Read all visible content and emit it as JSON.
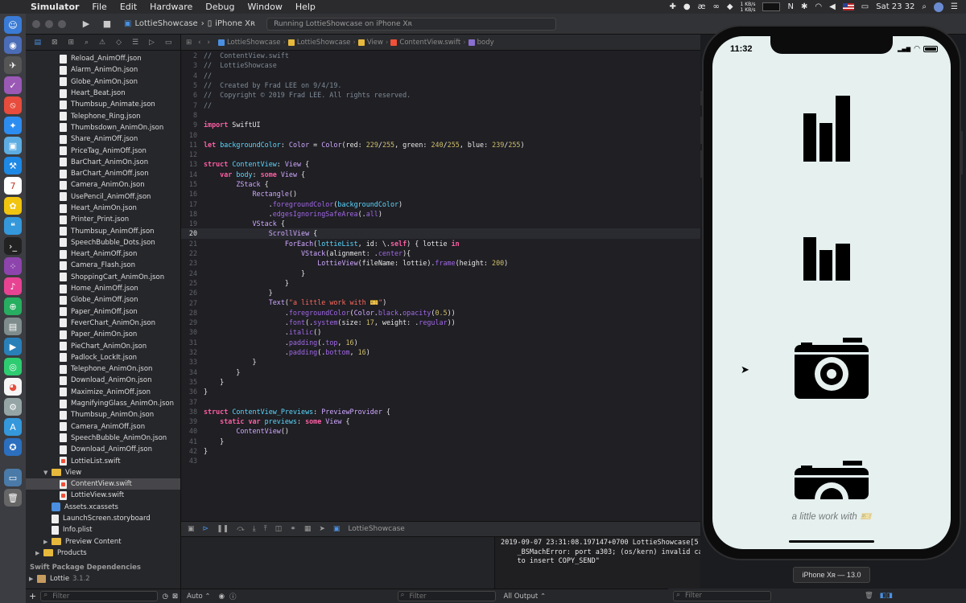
{
  "menubar": {
    "items": [
      "Simulator",
      "File",
      "Edit",
      "Hardware",
      "Debug",
      "Window",
      "Help"
    ],
    "net_up": "1 KB/s",
    "net_down": "1 KB/s",
    "clock": "Sat 23 32"
  },
  "toolbar": {
    "scheme": "LottieShowcase",
    "device": "iPhone Xʀ",
    "activity": "Running LottieShowcase on iPhone Xʀ"
  },
  "navigator": {
    "files": [
      "Reload_AnimOff.json",
      "Alarm_AnimOn.json",
      "Globe_AnimOn.json",
      "Heart_Beat.json",
      "Thumbsup_Animate.json",
      "Telephone_Ring.json",
      "Thumbsdown_AnimOn.json",
      "Share_AnimOff.json",
      "PriceTag_AnimOff.json",
      "BarChart_AnimOn.json",
      "BarChart_AnimOff.json",
      "Camera_AnimOn.json",
      "UsePencil_AnimOff.json",
      "Heart_AnimOn.json",
      "Printer_Print.json",
      "Thumbsup_AnimOff.json",
      "SpeechBubble_Dots.json",
      "Heart_AnimOff.json",
      "Camera_Flash.json",
      "ShoppingCart_AnimOn.json",
      "Home_AnimOff.json",
      "Globe_AnimOff.json",
      "Paper_AnimOff.json",
      "FeverChart_AnimOn.json",
      "Paper_AnimOn.json",
      "PieChart_AnimOn.json",
      "Padlock_LockIt.json",
      "Telephone_AnimOn.json",
      "Download_AnimOn.json",
      "Maximize_AnimOff.json",
      "MagnifyingGlass_AnimOn.json",
      "Thumbsup_AnimOn.json",
      "Camera_AnimOff.json",
      "SpeechBubble_AnimOn.json",
      "Download_AnimOff.json"
    ],
    "lottie_list": "LottieList.swift",
    "view_folder": "View",
    "content_view": "ContentView.swift",
    "lottie_view": "LottieView.swift",
    "assets": "Assets.xcassets",
    "launch_screen": "LaunchScreen.storyboard",
    "info_plist": "Info.plist",
    "preview_content": "Preview Content",
    "products": "Products",
    "packages_header": "Swift Package Dependencies",
    "package_name": "Lottie",
    "package_version": "3.1.2",
    "filter_placeholder": "Filter"
  },
  "jumpbar": {
    "crumbs": [
      "LottieShowcase",
      "LottieShowcase",
      "View",
      "ContentView.swift",
      "body"
    ]
  },
  "editor": {
    "current_line": 20,
    "lines": [
      {
        "n": 2,
        "html": "<span class='cm'>//  ContentView.swift</span>"
      },
      {
        "n": 3,
        "html": "<span class='cm'>//  LottieShowcase</span>"
      },
      {
        "n": 4,
        "html": "<span class='cm'>//</span>"
      },
      {
        "n": 5,
        "html": "<span class='cm'>//  Created by Frad LEE on 9/4/19.</span>"
      },
      {
        "n": 6,
        "html": "<span class='cm'>//  Copyright © 2019 Frad LEE. All rights reserved.</span>"
      },
      {
        "n": 7,
        "html": "<span class='cm'>//</span>"
      },
      {
        "n": 8,
        "html": ""
      },
      {
        "n": 9,
        "html": "<span class='kw'>import</span> SwiftUI"
      },
      {
        "n": 10,
        "html": ""
      },
      {
        "n": 11,
        "html": "<span class='kw'>let</span> <span class='ty'>backgroundColor</span>: <span class='tyu'>Color</span> = <span class='tyu'>Color</span>(red: <span class='num'>229</span>/<span class='num'>255</span>, green: <span class='num'>240</span>/<span class='num'>255</span>, blue: <span class='num'>239</span>/<span class='num'>255</span>)"
      },
      {
        "n": 12,
        "html": ""
      },
      {
        "n": 13,
        "html": "<span class='kw'>struct</span> <span class='ty'>ContentView</span>: <span class='tyu'>View</span> {"
      },
      {
        "n": 14,
        "html": "    <span class='kw'>var</span> <span class='ty'>body</span>: <span class='kw'>some</span> <span class='tyu'>View</span> {"
      },
      {
        "n": 15,
        "html": "        <span class='tyu'>ZStack</span> {"
      },
      {
        "n": 16,
        "html": "            <span class='tyu'>Rectangle</span>()"
      },
      {
        "n": 17,
        "html": "                .<span class='fn'>foregroundColor</span>(<span class='ty'>backgroundColor</span>)"
      },
      {
        "n": 18,
        "html": "                .<span class='fn'>edgesIgnoringSafeArea</span>(.<span class='dot'>all</span>)"
      },
      {
        "n": 19,
        "html": "            <span class='tyu'>VStack</span> {"
      },
      {
        "n": 20,
        "html": "                <span class='tyu'>ScrollView</span> {"
      },
      {
        "n": 21,
        "html": "                    <span class='tyu'>ForEach</span>(<span class='ty'>lottieList</span>, id: \\.<span class='kw'>self</span>) { lottie <span class='kw'>in</span>"
      },
      {
        "n": 22,
        "html": "                        <span class='tyu'>VStack</span>(alignment: .<span class='dot'>center</span>){"
      },
      {
        "n": 23,
        "html": "                            <span class='tyu'>LottieView</span>(fileName: lottie).<span class='fn'>frame</span>(height: <span class='num'>200</span>)"
      },
      {
        "n": 24,
        "html": "                        }"
      },
      {
        "n": 25,
        "html": "                    }"
      },
      {
        "n": 26,
        "html": "                }"
      },
      {
        "n": 27,
        "html": "                <span class='tyu'>Text</span>(<span class='str'>\"a little work with 🎫\"</span>)"
      },
      {
        "n": 28,
        "html": "                    .<span class='fn'>foregroundColor</span>(<span class='tyu'>Color</span>.<span class='dot'>black</span>.<span class='fn'>opacity</span>(<span class='num'>0.5</span>))"
      },
      {
        "n": 29,
        "html": "                    .<span class='fn'>font</span>(.<span class='fn'>system</span>(size: <span class='num'>17</span>, weight: .<span class='dot'>regular</span>))"
      },
      {
        "n": 30,
        "html": "                    .<span class='fn'>italic</span>()"
      },
      {
        "n": 31,
        "html": "                    .<span class='fn'>padding</span>(.<span class='dot'>top</span>, <span class='num'>16</span>)"
      },
      {
        "n": 32,
        "html": "                    .<span class='fn'>padding</span>(.<span class='dot'>bottom</span>, <span class='num'>16</span>)"
      },
      {
        "n": 33,
        "html": "            }"
      },
      {
        "n": 34,
        "html": "        }"
      },
      {
        "n": 35,
        "html": "    }"
      },
      {
        "n": 36,
        "html": "}"
      },
      {
        "n": 37,
        "html": ""
      },
      {
        "n": 38,
        "html": "<span class='kw'>struct</span> <span class='ty'>ContentView_Previews</span>: <span class='tyu'>PreviewProvider</span> {"
      },
      {
        "n": 39,
        "html": "    <span class='kw'>static var</span> <span class='ty'>previews</span>: <span class='kw'>some</span> <span class='tyu'>View</span> {"
      },
      {
        "n": 40,
        "html": "        <span class='tyu'>ContentView</span>()"
      },
      {
        "n": 41,
        "html": "    }"
      },
      {
        "n": 42,
        "html": "}"
      },
      {
        "n": 43,
        "html": ""
      }
    ]
  },
  "debug": {
    "target": "LottieShowcase",
    "auto_label": "Auto ⌃",
    "filter_placeholder": "Filter",
    "all_output": "All Output ⌃",
    "console_lines": [
      "2019-09-07 23:31:08.197147+0700 LottieShowcase[5",
      "    _BSMachError: port a303; (os/kern) invalid cap",
      "    to insert COPY_SEND\""
    ]
  },
  "simulator": {
    "time": "11:32",
    "caption": "a little work with 🎫",
    "device_label": "iPhone Xʀ — 13.0"
  },
  "colors": {
    "phone_background": "#e5f0ef",
    "accent": "#4a90e2"
  }
}
